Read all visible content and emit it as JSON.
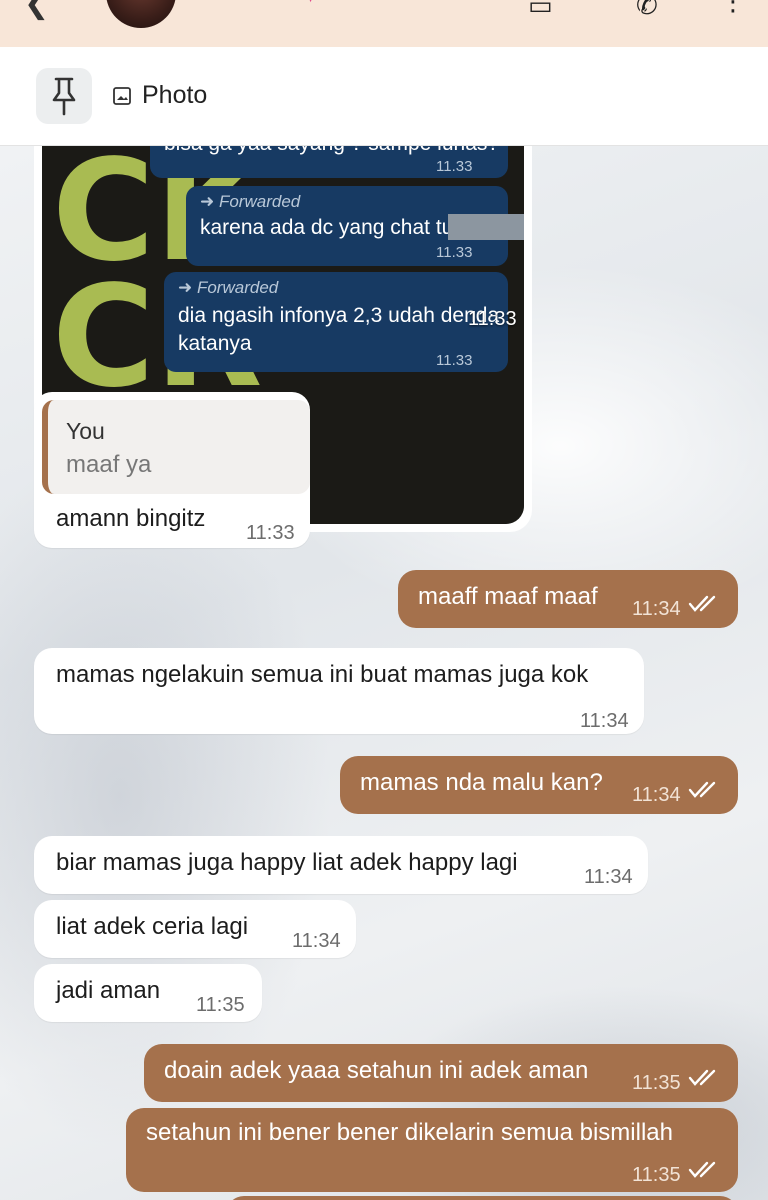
{
  "header": {
    "avatar_alt": ""
  },
  "pinned": {
    "label": "Photo"
  },
  "image_message": {
    "embedded": [
      {
        "text": "bisa ga yaa sayang ? sampe lunas?",
        "time": "11.33"
      },
      {
        "forward": "Forwarded",
        "text": "karena ada dc yang chat tu",
        "time": "11.33"
      },
      {
        "forward": "Forwarded",
        "text1": "dia ngasih infonya 2,3 udah denda",
        "text2": "katanya",
        "time": "11.33"
      }
    ],
    "time": "11:33"
  },
  "reply_message": {
    "quoted_author": "You",
    "quoted_text": "maaf ya",
    "text": "amann bingitz",
    "time": "11:33"
  },
  "messages": [
    {
      "dir": "out",
      "text": "maaff maaf maaf",
      "time": "11:34"
    },
    {
      "dir": "in",
      "text": "mamas ngelakuin semua ini buat mamas juga kok",
      "time": "11:34"
    },
    {
      "dir": "out",
      "text": "mamas nda malu kan?",
      "time": "11:34"
    },
    {
      "dir": "in",
      "text": "biar mamas juga happy liat adek happy lagi",
      "time": "11:34"
    },
    {
      "dir": "in",
      "text": "liat adek ceria lagi",
      "time": "11:34"
    },
    {
      "dir": "in",
      "text": "jadi aman",
      "time": "11:35"
    },
    {
      "dir": "out",
      "text": "doain adek yaaa setahun ini adek aman",
      "time": "11:35"
    },
    {
      "dir": "out",
      "text": "setahun ini bener bener dikelarin semua bismillah",
      "time": "11:35"
    }
  ],
  "colors": {
    "outgoing": "#a5714c",
    "incoming": "#ffffff",
    "header": "#f8e6d8"
  }
}
